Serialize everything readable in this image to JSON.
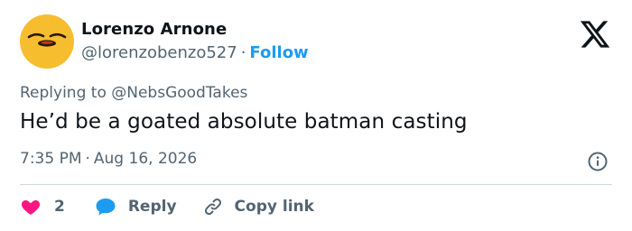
{
  "author": {
    "name": "Lorenzo Arnone",
    "handle": "@lorenzobenzo527",
    "separator": "·",
    "follow_label": "Follow",
    "avatar_color": "#f6bd2f"
  },
  "reply_context": {
    "prefix": "Replying to",
    "mention": "@NebsGoodTakes"
  },
  "tweet": {
    "text": "He’d be a goated absolute batman casting",
    "time": "7:35 PM",
    "separator": "·",
    "date": "Aug 16, 2026"
  },
  "actions": {
    "like_count": "2",
    "reply_label": "Reply",
    "copy_label": "Copy link"
  },
  "icons": {
    "brand": "x-logo-icon",
    "info": "info-icon",
    "like": "heart-icon",
    "reply": "speech-bubble-icon",
    "copy": "link-icon"
  },
  "colors": {
    "accent": "#1d9bf0",
    "like": "#f91880",
    "text": "#0f1419",
    "muted": "#536471",
    "divider": "#cfd9de"
  }
}
